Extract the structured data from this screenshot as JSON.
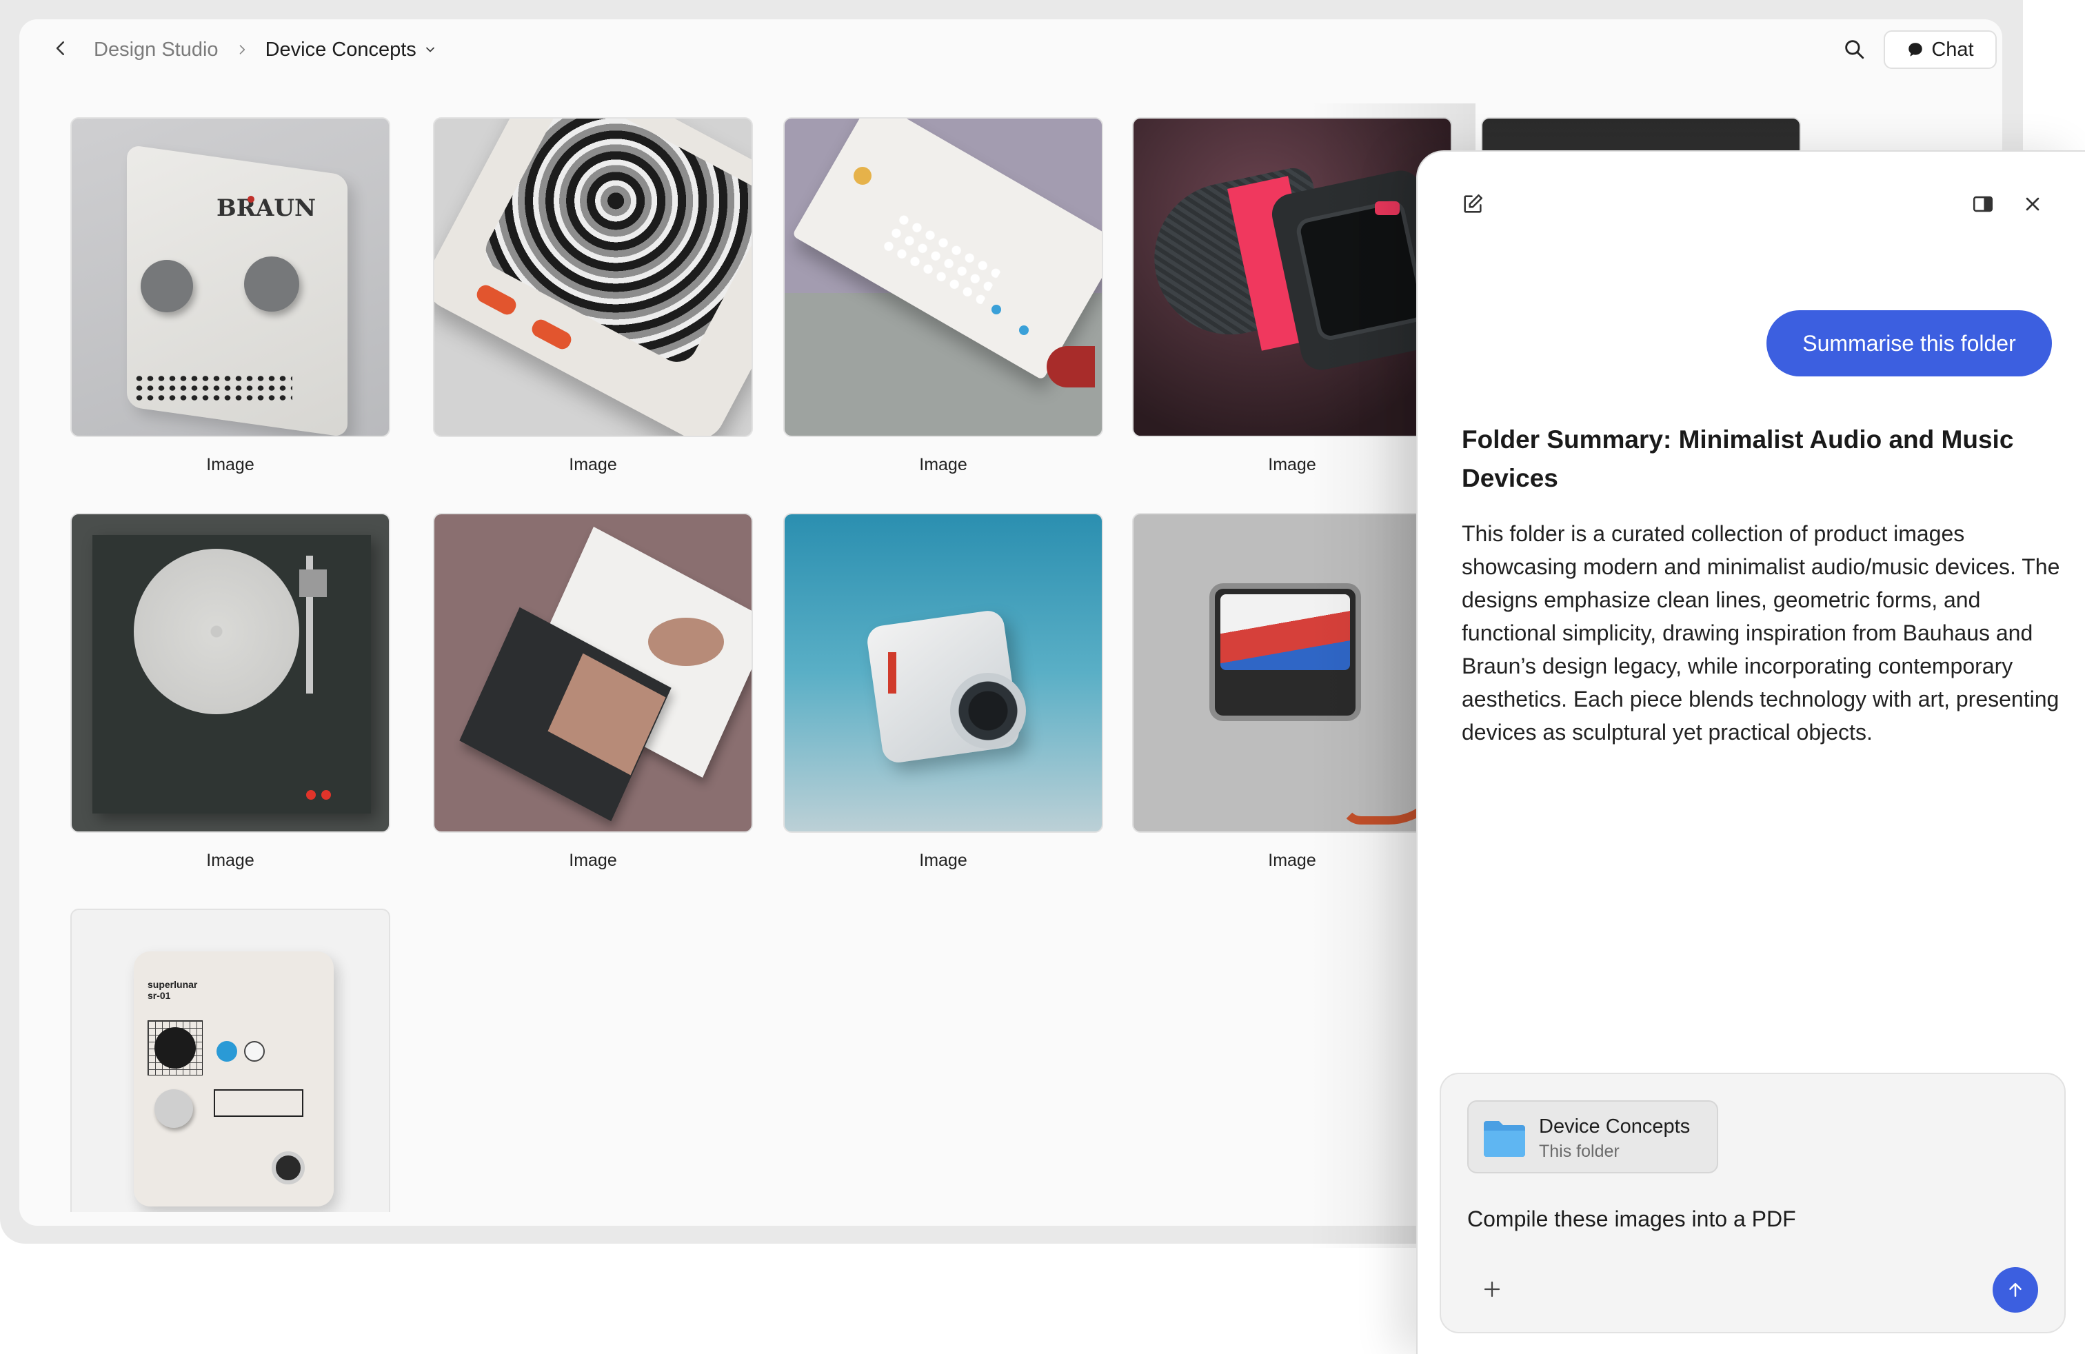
{
  "header": {
    "breadcrumb_root": "Design Studio",
    "breadcrumb_current": "Device Concepts",
    "chat_label": "Chat"
  },
  "grid": {
    "items": [
      {
        "caption": "Image",
        "art": "braun-pedal"
      },
      {
        "caption": "Image",
        "art": "handheld-device"
      },
      {
        "caption": "Image",
        "art": "synth-board"
      },
      {
        "caption": "Image",
        "art": "red-camera"
      },
      {
        "caption": "Image",
        "art": "turntable"
      },
      {
        "caption": "Image",
        "art": "modular-panels"
      },
      {
        "caption": "Image",
        "art": "cube-camera"
      },
      {
        "caption": "Image",
        "art": "wrist-device"
      },
      {
        "caption": "",
        "art": "superlunar-pedal"
      }
    ]
  },
  "chat": {
    "user_message": "Summarise this folder",
    "summary_title": "Folder Summary: Minimalist Audio and Music Devices",
    "summary_body": "This folder is a curated collection of product images showcasing modern and minimalist audio/music devices. The designs emphasize clean lines, geometric forms, and functional simplicity, drawing inspiration from Bauhaus and Braun’s design legacy, while incorporating contemporary aesthetics. Each piece blends technology with art, presenting devices as sculptural yet practical objects.",
    "attachment_name": "Device Concepts",
    "attachment_sub": "This folder",
    "input_value": "Compile these images into a PDF"
  },
  "colors": {
    "accent": "#3c5fe0",
    "folder": "#5aaef0"
  }
}
